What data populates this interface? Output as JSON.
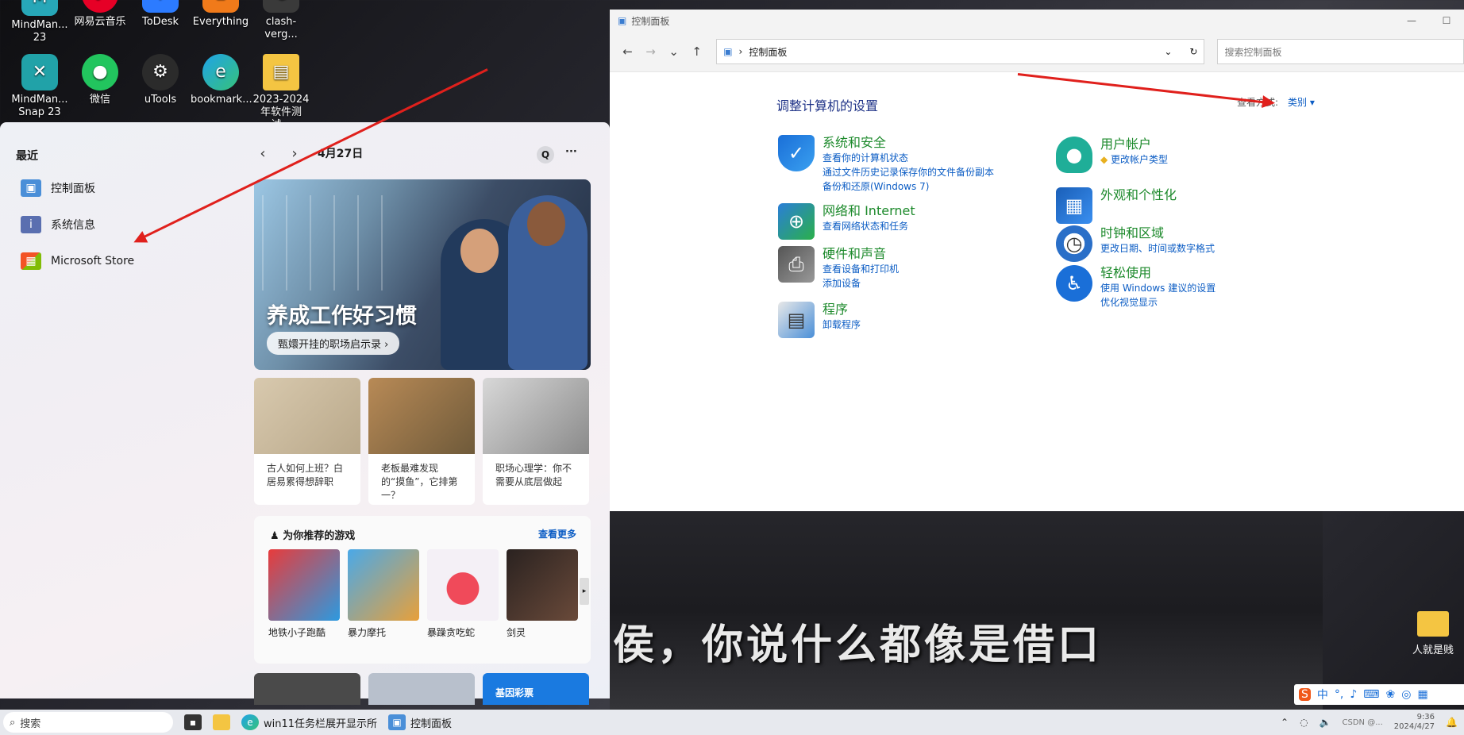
{
  "desktop": {
    "icons_row1": [
      {
        "label": "MindMan...\n23",
        "icon": "mindmanager-icon"
      },
      {
        "label": "网易云音乐",
        "icon": "netease-music-icon"
      },
      {
        "label": "ToDesk",
        "icon": "todesk-icon"
      },
      {
        "label": "Everything",
        "icon": "everything-icon"
      },
      {
        "label": "clash-verg...",
        "icon": "clash-icon"
      }
    ],
    "icons_row2": [
      {
        "label": "MindMan...\nSnap 23",
        "icon": "mindmanager-snap-icon"
      },
      {
        "label": "微信",
        "icon": "wechat-icon"
      },
      {
        "label": "uTools",
        "icon": "utools-icon"
      },
      {
        "label": "bookmark...",
        "icon": "edge-icon"
      },
      {
        "label": "2023-2024\n年软件测试...",
        "icon": "folder-icon"
      }
    ],
    "video_subtitle": "侯，你说什么都像是借口",
    "right_folder": "人就是贱"
  },
  "start_menu": {
    "recent_heading": "最近",
    "recent_items": [
      {
        "label": "控制面板",
        "icon": "control-panel-icon"
      },
      {
        "label": "系统信息",
        "icon": "system-info-icon"
      },
      {
        "label": "Microsoft Store",
        "icon": "store-icon"
      }
    ],
    "date": "4月27日",
    "search_btn": "Q",
    "more_btn": "···",
    "hero": {
      "title": "养成工作好习惯",
      "pill": "甄嬛开挂的职场启示录"
    },
    "cards": [
      {
        "text": "古人如何上班？白居易累得想辞职"
      },
      {
        "text": "老板最难发现的“摸鱼”，它排第一？"
      },
      {
        "text": "职场心理学：你不需要从底层做起"
      }
    ],
    "games": {
      "heading": "为你推荐的游戏",
      "more": "查看更多",
      "items": [
        {
          "label": "地铁小子跑酷"
        },
        {
          "label": "暴力摩托"
        },
        {
          "label": "暴躁贪吃蛇"
        },
        {
          "label": "剑灵"
        }
      ]
    },
    "bottom_card_label": "基因彩票"
  },
  "control_panel": {
    "window_title": "控制面板",
    "address": "控制面板",
    "search_placeholder": "搜索控制面板",
    "heading": "调整计算机的设置",
    "view_by_label": "查看方式:",
    "view_by_value": "类别 ▾",
    "categories_left": [
      {
        "title": "系统和安全",
        "icon": "shield-icon",
        "links": [
          "查看你的计算机状态",
          "通过文件历史记录保存你的文件备份副本",
          "备份和还原(Windows 7)"
        ]
      },
      {
        "title": "网络和 Internet",
        "icon": "network-icon",
        "links": [
          "查看网络状态和任务"
        ]
      },
      {
        "title": "硬件和声音",
        "icon": "printer-icon",
        "links": [
          "查看设备和打印机",
          "添加设备"
        ]
      },
      {
        "title": "程序",
        "icon": "programs-icon",
        "links": [
          "卸载程序"
        ]
      }
    ],
    "categories_right": [
      {
        "title": "用户帐户",
        "icon": "user-icon",
        "links": [
          "更改帐户类型"
        ]
      },
      {
        "title": "外观和个性化",
        "icon": "appearance-icon",
        "links": []
      },
      {
        "title": "时钟和区域",
        "icon": "clock-icon",
        "links": [
          "更改日期、时间或数字格式"
        ]
      },
      {
        "title": "轻松使用",
        "icon": "accessibility-icon",
        "links": [
          "使用 Windows 建议的设置",
          "优化视觉显示"
        ]
      }
    ]
  },
  "taskbar": {
    "search_placeholder": "搜索",
    "items": [
      {
        "label": "",
        "icon": "task-view-icon"
      },
      {
        "label": "",
        "icon": "file-explorer-icon"
      },
      {
        "label": "win11任务栏展开显示所",
        "icon": "edge-icon"
      },
      {
        "label": "控制面板",
        "icon": "control-panel-icon"
      }
    ],
    "ime": "中",
    "clock_time": "9:36",
    "clock_date": "2024/4/27",
    "watermark": "CSDN @..."
  },
  "colors": {
    "accent_green": "#1d8a2c",
    "link_blue": "#0b5cc4",
    "arrow_red": "#e0201c"
  }
}
